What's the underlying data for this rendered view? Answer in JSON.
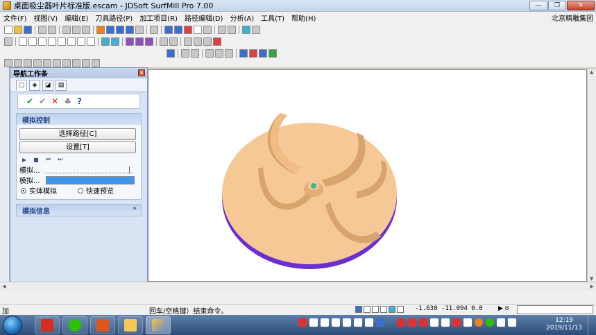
{
  "window": {
    "title": "桌面吸尘器叶片标准版.escam - JDSoft SurfMill Pro 7.00",
    "minimize_label": "—",
    "restore_label": "❐",
    "close_label": "✕"
  },
  "menu": {
    "items": [
      "文件(F)",
      "视图(V)",
      "编辑(E)",
      "刀具路径(P)",
      "加工项目(R)",
      "路径编辑(D)",
      "分析(A)",
      "工具(T)",
      "帮助(H)"
    ],
    "right_text": "北京精雕集团"
  },
  "panel": {
    "title": "导航工作条",
    "close_label": "x",
    "actions": {
      "ok": "✔",
      "ok_continue": "✔",
      "cancel": "✕",
      "preview": "♣",
      "help": "?"
    },
    "sim_control": {
      "header": "模拟控制",
      "select_path_button": "选择路径[C]",
      "settings_button": "设置[T]",
      "play_controls": [
        "▶",
        "■",
        "⏮",
        "⏭"
      ],
      "speed_label": "模拟...",
      "progress_label": "模拟...",
      "progress_fraction": 1.0,
      "radio_solid": "实体模拟",
      "radio_fast": "快速预览",
      "selected_mode": "solid"
    },
    "sim_info": {
      "header": "模拟信息",
      "chevron": "»"
    }
  },
  "command": {
    "message": "回车/空格键）结束命令。",
    "left_text": "加"
  },
  "status": {
    "coords": "-1.630  -11.094  0.0",
    "arrow": "▶ ʊ"
  },
  "taskbar": {
    "apps": [
      "pdf-reader",
      "wechat",
      "presentation",
      "file-explorer",
      "surfmill"
    ],
    "time": "12:19",
    "date": "2019/11/13"
  },
  "colors": {
    "part": "#f5c896",
    "part_shadow": "#d9a36e",
    "base_edge": "#6a2fd0",
    "hub": "#3ab894"
  }
}
